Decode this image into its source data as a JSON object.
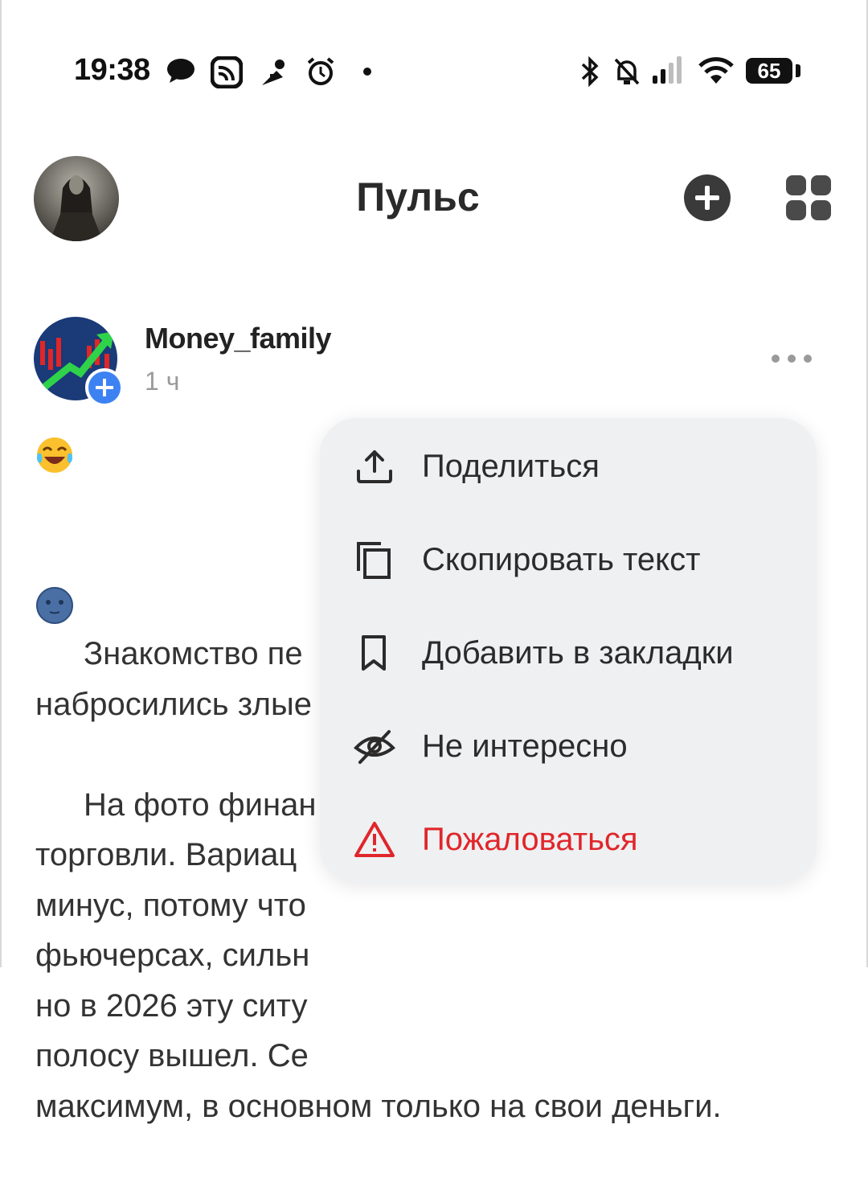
{
  "status_bar": {
    "time": "19:38",
    "battery": "65"
  },
  "header": {
    "title": "Пульс"
  },
  "post": {
    "author": "Money_family",
    "time": "1 ч",
    "text": "Знакомство пе\nнабросились злые\n\nНа фото финан\nторговли. Вариац\nминус, потому что\nфьючерсах, сильн\nно в 2026 эту ситу\nполосу вышел. Се\nмаксимум, в основном только на свои деньги."
  },
  "menu": {
    "items": [
      {
        "label": "Поделиться",
        "icon": "share-icon"
      },
      {
        "label": "Скопировать текст",
        "icon": "copy-icon"
      },
      {
        "label": "Добавить в закладки",
        "icon": "bookmark-icon"
      },
      {
        "label": "Не интересно",
        "icon": "eye-off-icon"
      },
      {
        "label": "Пожаловаться",
        "icon": "warning-icon",
        "color": "#e0262a"
      }
    ]
  },
  "colors": {
    "accent": "#3d82f2",
    "danger": "#e0262a",
    "menu_bg": "#eff0f2"
  }
}
